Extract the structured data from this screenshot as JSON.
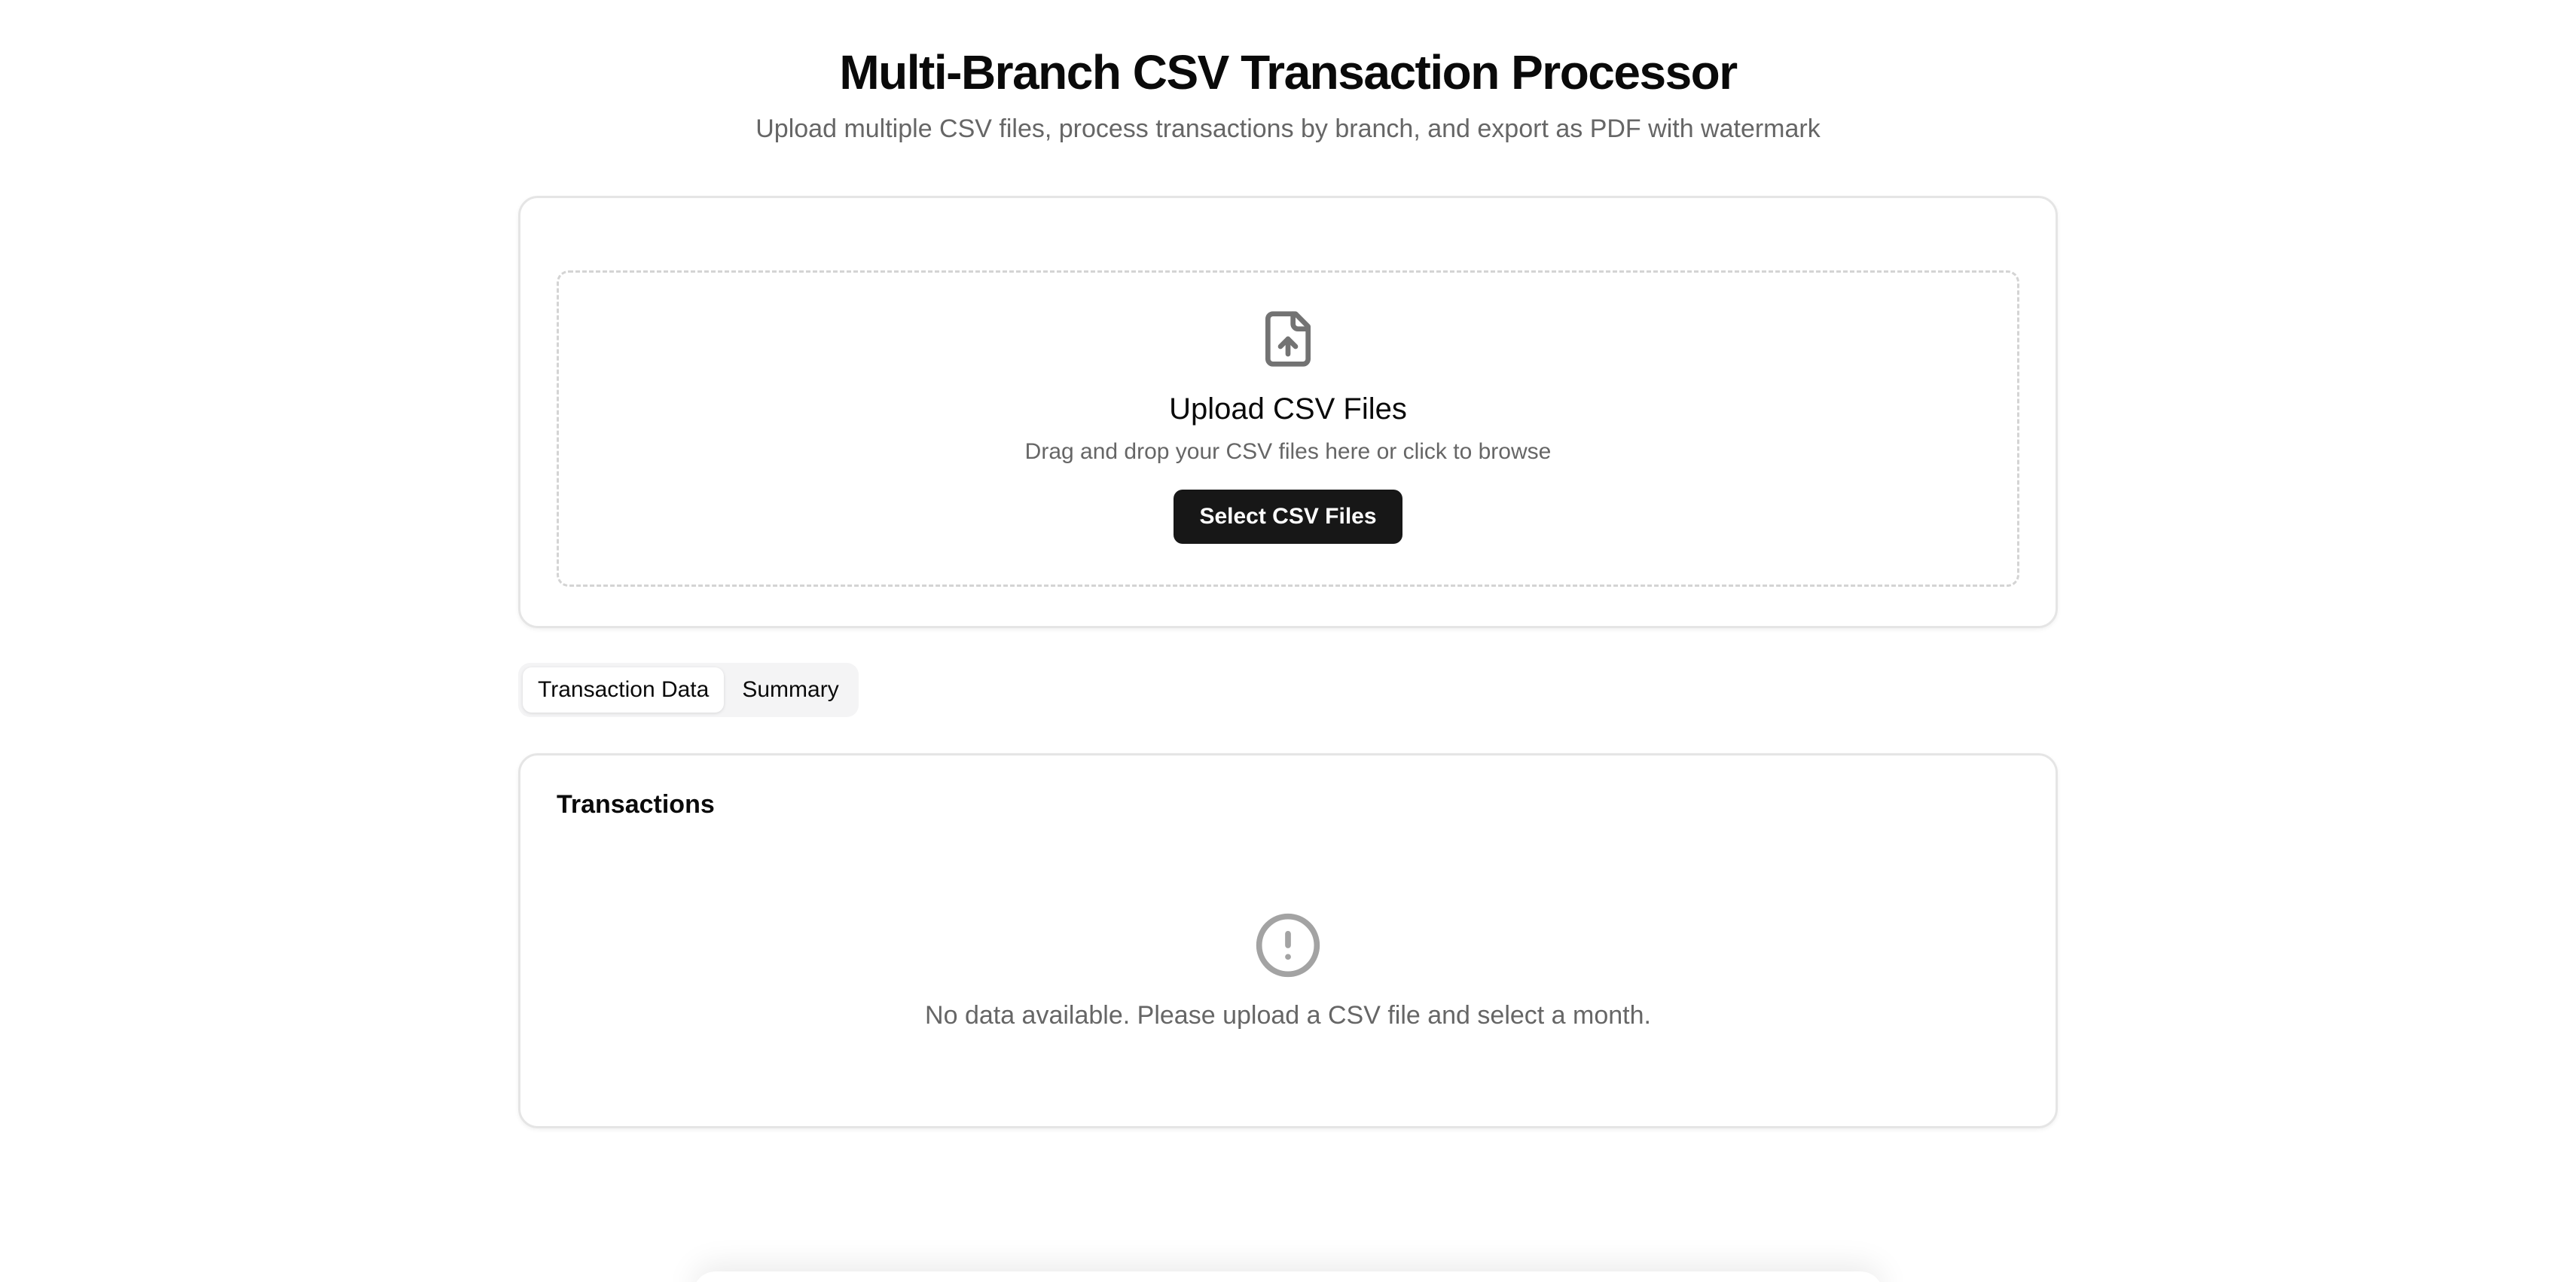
{
  "header": {
    "title": "Multi-Branch CSV Transaction Processor",
    "subtitle": "Upload multiple CSV files, process transactions by branch, and export as PDF with watermark"
  },
  "upload": {
    "icon": "file-upload-icon",
    "title": "Upload CSV Files",
    "description": "Drag and drop your CSV files here or click to browse",
    "button_label": "Select CSV Files"
  },
  "tabs": [
    {
      "label": "Transaction Data",
      "active": true
    },
    {
      "label": "Summary",
      "active": false
    }
  ],
  "transactions": {
    "title": "Transactions",
    "empty_icon": "alert-circle-icon",
    "empty_message": "No data available. Please upload a CSV file and select a month."
  },
  "colors": {
    "primary_button": "#171717",
    "muted_text": "#666666",
    "border": "#e5e5e5",
    "tab_background": "#f4f4f5"
  }
}
